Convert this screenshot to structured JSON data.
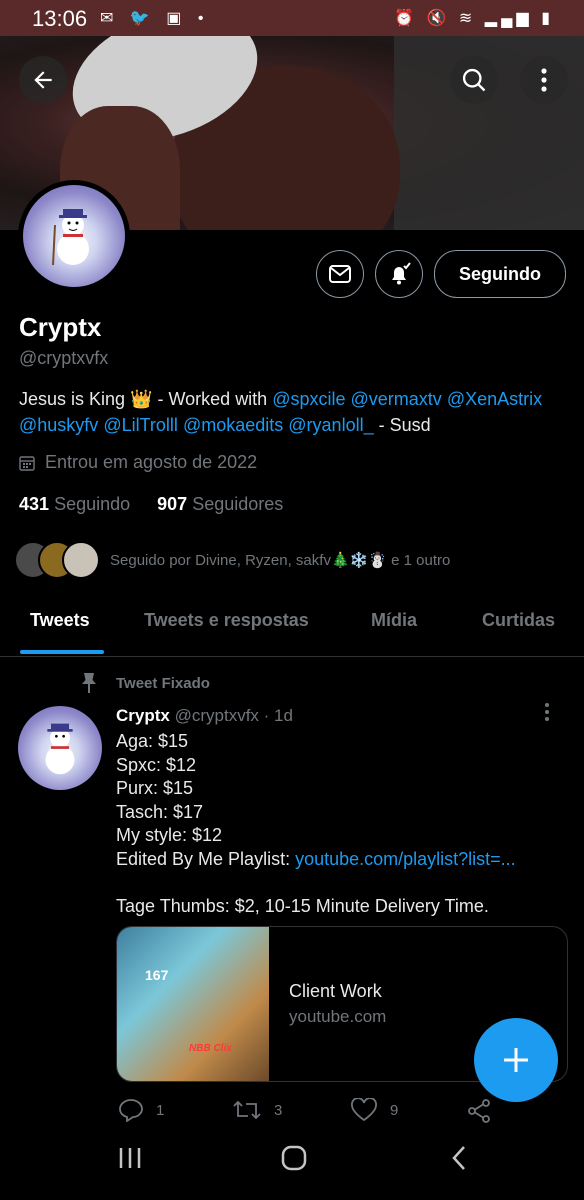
{
  "status_bar": {
    "time": "13:06",
    "dot": "•"
  },
  "profile": {
    "name": "Cryptx",
    "handle": "@cryptxvfx",
    "follow_button": "Seguindo",
    "bio_prefix": "Jesus is King",
    "bio_crown": "👑",
    "bio_mid": " - Worked with ",
    "bio_links": [
      "@spxcile",
      "@vermaxtv",
      "@XenAstrix",
      "@huskyfv",
      "@LilTrolll",
      "@mokaedits",
      "@ryanloll_"
    ],
    "bio_suffix": " - Susd",
    "joined": "Entrou em agosto de 2022",
    "following_count": "431",
    "following_label": "Seguindo",
    "followers_count": "907",
    "followers_label": "Seguidores",
    "followed_by": "Seguido por Divine, Ryzen, sakfv🎄❄️☃️ e 1 outro"
  },
  "tabs": [
    "Tweets",
    "Tweets e respostas",
    "Mídia",
    "Curtidas"
  ],
  "pinned_tweet": {
    "pinned_label": "Tweet Fixado",
    "author": "Cryptx",
    "handle": "@cryptxvfx",
    "time": "· 1d",
    "lines": [
      "Aga: $15",
      "Spxc: $12",
      "Purx: $15",
      "Tasch: $17",
      "My style: $12"
    ],
    "playlist_prefix": "Edited By Me Playlist: ",
    "playlist_link": "youtube.com/playlist?list=...",
    "thumbs_line": "Tage Thumbs: $2, 10-15 Minute Delivery Time.",
    "card": {
      "title": "Client Work",
      "domain": "youtube.com",
      "thumb_number": "167",
      "thumb_tag": "NBB Clix"
    },
    "reply_count": "1",
    "retweet_count": "3",
    "like_count": "9"
  },
  "colors": {
    "accent": "#1d9bf0",
    "background": "#000000",
    "secondary_text": "#71767b",
    "status_bar": "#5a2a2a"
  }
}
